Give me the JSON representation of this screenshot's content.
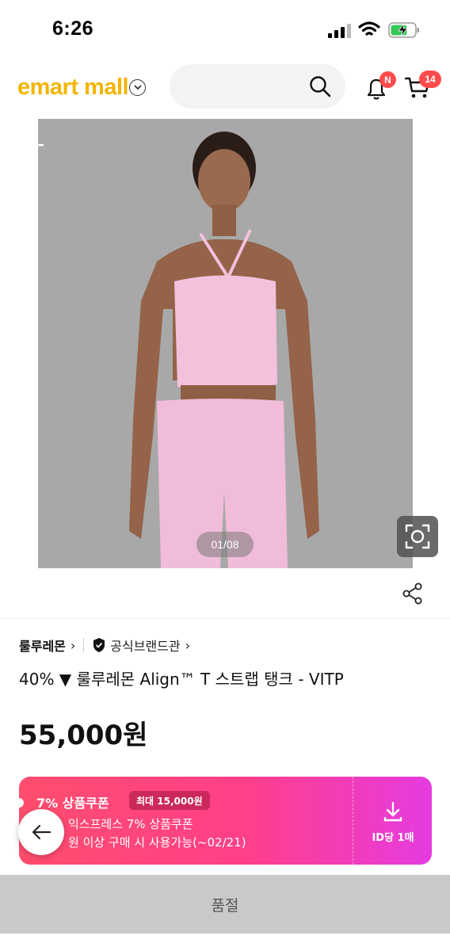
{
  "status_bar": {
    "time": "6:26"
  },
  "header": {
    "logo_e": "e",
    "logo_rest": "mart mall",
    "cart_count": "14",
    "notification_badge": "N"
  },
  "product": {
    "image_counter": "01/08",
    "brand": "룰루레몬",
    "official_label": "공식브랜드관",
    "title": "40% ▼ 룰루레몬 Align™ T 스트랩 탱크 - VITP",
    "price": "55,000원",
    "image_bg_color": "#a9a9a9",
    "garment_color": "#f3c1dc"
  },
  "coupon": {
    "title": "7% 상품쿠폰",
    "max_badge": "최대 15,000원",
    "line1": "익스프레스 7% 상품쿠폰",
    "line2": "원 이상 구매 시 사용가능(~02/21)",
    "download_label": "ID당 1매",
    "gradient_start": "#ff4d6d",
    "gradient_end": "#e53be0"
  },
  "bottom_bar": {
    "soldout_label": "품절"
  }
}
